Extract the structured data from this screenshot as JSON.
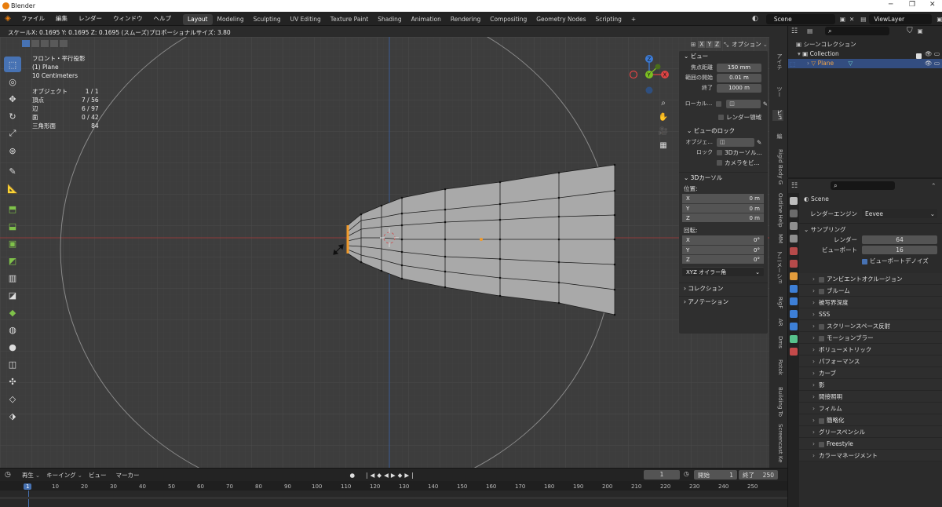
{
  "window": {
    "title": "Blender"
  },
  "menu": [
    "ファイル",
    "編集",
    "レンダー",
    "ウィンドウ",
    "ヘルプ"
  ],
  "workspaces": [
    "Layout",
    "Modeling",
    "Sculpting",
    "UV Editing",
    "Texture Paint",
    "Shading",
    "Animation",
    "Rendering",
    "Compositing",
    "Geometry Nodes",
    "Scripting"
  ],
  "active_workspace": "Layout",
  "add_workspace": "+",
  "scene": {
    "name": "Scene",
    "viewlayer": "ViewLayer"
  },
  "operator_status": "スケールX: 0.1695  Y: 0.1695  Z: 0.1695 (スムーズ)プロポーショナルサイズ: 3.80",
  "viewport": {
    "view_name": "フロント・平行投影",
    "object": "(1) Plane",
    "scale": "10 Centimeters",
    "stats": [
      {
        "label": "オブジェクト",
        "value": "1 / 1"
      },
      {
        "label": "頂点",
        "value": "7 / 56"
      },
      {
        "label": "辺",
        "value": "6 / 97"
      },
      {
        "label": "面",
        "value": "0 / 42"
      },
      {
        "label": "三角形面",
        "value": "84"
      }
    ],
    "header_axes": [
      "X",
      "Y",
      "Z"
    ],
    "options": "オプション",
    "gizmo": {
      "x": "X",
      "y": "Y",
      "z": "Z"
    }
  },
  "npanel": {
    "view_header": "ビュー",
    "focal_label": "焦点距離",
    "focal_value": "150 mm",
    "clip_start_label": "範囲の開始",
    "clip_start_value": "0.01 m",
    "clip_end_label": "終了",
    "clip_end_value": "1000 m",
    "local_camera_label": "ローカル...",
    "render_region": "レンダー領域",
    "view_lock_header": "ビューのロック",
    "lock_object_label": "オブジェ...",
    "lock_label": "ロック",
    "lock_cursor": "3Dカーソル...",
    "lock_camera": "カメラをビ...",
    "cursor_header": "3Dカーソル",
    "location_label": "位置:",
    "loc": [
      {
        "axis": "X",
        "value": "0 m"
      },
      {
        "axis": "Y",
        "value": "0 m"
      },
      {
        "axis": "Z",
        "value": "0 m"
      }
    ],
    "rotation_label": "回転:",
    "rot": [
      {
        "axis": "X",
        "value": "0°"
      },
      {
        "axis": "Y",
        "value": "0°"
      },
      {
        "axis": "Z",
        "value": "0°"
      }
    ],
    "rotation_mode": "XYZ オイラー角",
    "collection_header": "コレクション",
    "annotation_header": "アノテーション"
  },
  "npanel_tabs": [
    "アイテ",
    "ツー",
    "ビュ",
    "編",
    "Rigid Body G",
    "Outline Help",
    "MM",
    "アニメーショ",
    "RigF",
    "AR",
    "Dms",
    "Rotok",
    "Building To",
    "Screencast Ke"
  ],
  "outliner": {
    "root": "シーンコレクション",
    "collection": "Collection",
    "object": "Plane"
  },
  "properties": {
    "scene_name": "Scene",
    "render_engine_label": "レンダーエンジン",
    "render_engine_value": "Eevee",
    "sampling_header": "サンプリング",
    "render_label": "レンダー",
    "render_value": "64",
    "viewport_label": "ビューポート",
    "viewport_value": "16",
    "viewport_denoise": "ビューポートデノイズ",
    "sections": [
      "アンビエントオクルージョン",
      "ブルーム",
      "被写界深度",
      "SSS",
      "スクリーンスペース反射",
      "モーションブラー",
      "ボリューメトリック",
      "パフォーマンス",
      "カーブ",
      "影",
      "間接照明",
      "フィルム",
      "簡略化",
      "グリースペンシル",
      "Freestyle",
      "カラーマネージメント"
    ]
  },
  "timeline": {
    "menu": [
      "再生",
      "キーイング",
      "ビュー",
      "マーカー"
    ],
    "current_frame": "1",
    "start_label": "開始",
    "start_value": "1",
    "end_label": "終了",
    "end_value": "250",
    "ticks": [
      "1",
      "10",
      "20",
      "30",
      "40",
      "50",
      "60",
      "70",
      "80",
      "90",
      "100",
      "110",
      "120",
      "130",
      "140",
      "150",
      "160",
      "170",
      "180",
      "190",
      "200",
      "210",
      "220",
      "230",
      "240",
      "250"
    ]
  }
}
